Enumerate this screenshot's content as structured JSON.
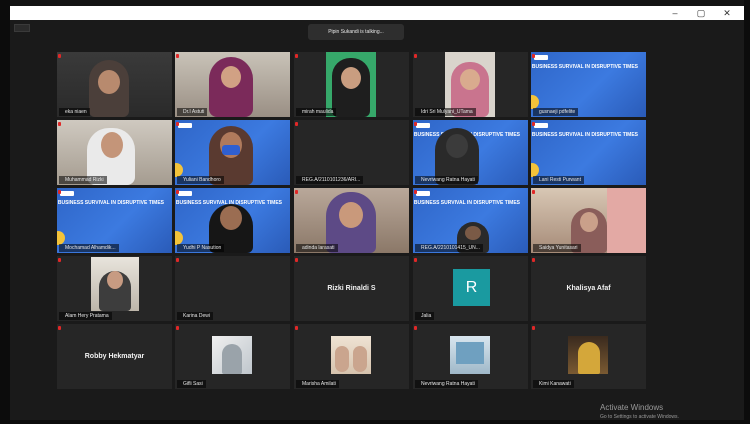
{
  "window": {
    "controls": [
      "–",
      "▢",
      "✕"
    ]
  },
  "speaker": {
    "talking_text": "Pipin Sukandi is talking..."
  },
  "slide_text": "BUSINESS SURVIVAL IN DISRUPTIVE TIMES",
  "participants": [
    {
      "name": "eka niaen",
      "kind": "camera"
    },
    {
      "name": "Dr.I Astuti",
      "kind": "camera"
    },
    {
      "name": "mirah maulida",
      "kind": "camera"
    },
    {
      "name": "Idri Sri Mulyani_UTama",
      "kind": "camera"
    },
    {
      "name": "gusnaeji pdfelite",
      "kind": "slide"
    },
    {
      "name": "Muhammad Rizki",
      "kind": "camera"
    },
    {
      "name": "Yuliani Bandhoro",
      "kind": "camera-slide"
    },
    {
      "name": "REG.A/2110101236/ARI...",
      "kind": "blank"
    },
    {
      "name": "Nevriwang Ratna Hayati",
      "kind": "camera-slide"
    },
    {
      "name": "Lani Resti Purwant",
      "kind": "slide"
    },
    {
      "name": "Mochamad Alhamdik...",
      "kind": "slide"
    },
    {
      "name": "Yudhi P Nasution",
      "kind": "camera-slide"
    },
    {
      "name": "adinda larasati",
      "kind": "camera"
    },
    {
      "name": "REG.A/2210101415_UN...",
      "kind": "camera-slide"
    },
    {
      "name": "Saidya Yunitasari",
      "kind": "camera"
    },
    {
      "name": "Alam Hery Pratama",
      "kind": "thumb"
    },
    {
      "name": "Karina Dewi",
      "kind": "blank"
    },
    {
      "name": "",
      "kind": "name",
      "display": "Rizki Rinaldi S"
    },
    {
      "name": "Jalia",
      "kind": "avatar",
      "initial": "R"
    },
    {
      "name": "",
      "kind": "name",
      "display": "Khalisya Afaf"
    },
    {
      "name": "",
      "kind": "name",
      "display": "Robby Hekmatyar"
    },
    {
      "name": "Gifli Sasi",
      "kind": "thumb"
    },
    {
      "name": "Marisha Amilati",
      "kind": "thumb"
    },
    {
      "name": "Nevriwang Ratna Hayati",
      "kind": "thumb"
    },
    {
      "name": "Kimi Kanawati",
      "kind": "thumb"
    }
  ],
  "watermark": {
    "title": "Activate Windows",
    "subtitle": "Go to Settings to activate Windows."
  },
  "colors": {
    "background": "#1a1a1a",
    "tile": "#262626",
    "slide_blue": "#2f66c8",
    "mic_muted": "#e02828",
    "avatar_teal": "#1a9aa0"
  }
}
